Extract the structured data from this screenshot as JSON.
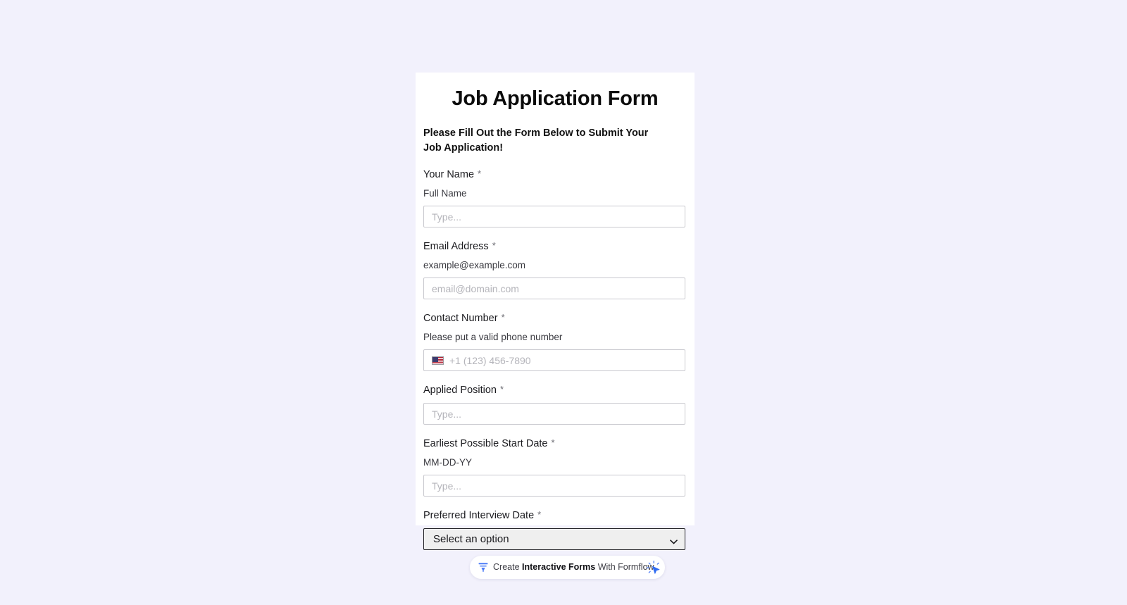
{
  "colors": {
    "page_background": "#f2f1fc",
    "card_background": "#ffffff",
    "accent_blue": "#3b6ef6",
    "input_border": "#c9c9cf",
    "select_background": "#efefef",
    "select_border": "#202024",
    "placeholder": "#b4b4ba"
  },
  "form": {
    "title": "Job Application Form",
    "subtitle": "Please Fill Out the Form Below to Submit Your Job Application!",
    "required_marker": "*",
    "fields": [
      {
        "id": "your-name",
        "label": "Your Name",
        "required": true,
        "help": "Full Name",
        "type": "text",
        "value": "",
        "placeholder": "Type..."
      },
      {
        "id": "email-address",
        "label": "Email Address",
        "required": true,
        "help": "example@example.com",
        "type": "email",
        "value": "",
        "placeholder": "email@domain.com"
      },
      {
        "id": "contact-number",
        "label": "Contact Number",
        "required": true,
        "help": "Please put a valid phone number",
        "type": "tel",
        "value": "",
        "placeholder": "+1 (123) 456-7890",
        "flag": "us-flag-icon"
      },
      {
        "id": "applied-position",
        "label": "Applied Position",
        "required": true,
        "help": "",
        "type": "text",
        "value": "",
        "placeholder": "Type..."
      },
      {
        "id": "earliest-start-date",
        "label": "Earliest Possible Start Date",
        "required": true,
        "help": "MM-DD-YY",
        "type": "text",
        "value": "",
        "placeholder": "Type..."
      },
      {
        "id": "preferred-interview-date",
        "label": "Preferred Interview Date",
        "required": true,
        "help": "",
        "type": "select",
        "value": "Select an option",
        "options": [
          "Select an option"
        ]
      }
    ]
  },
  "footer_badge": {
    "icon": "funnel-icon",
    "text_prefix": "Create ",
    "text_strong": "Interactive Forms",
    "text_suffix": " With Formflow",
    "cursor_icon": "click-cursor-icon"
  }
}
